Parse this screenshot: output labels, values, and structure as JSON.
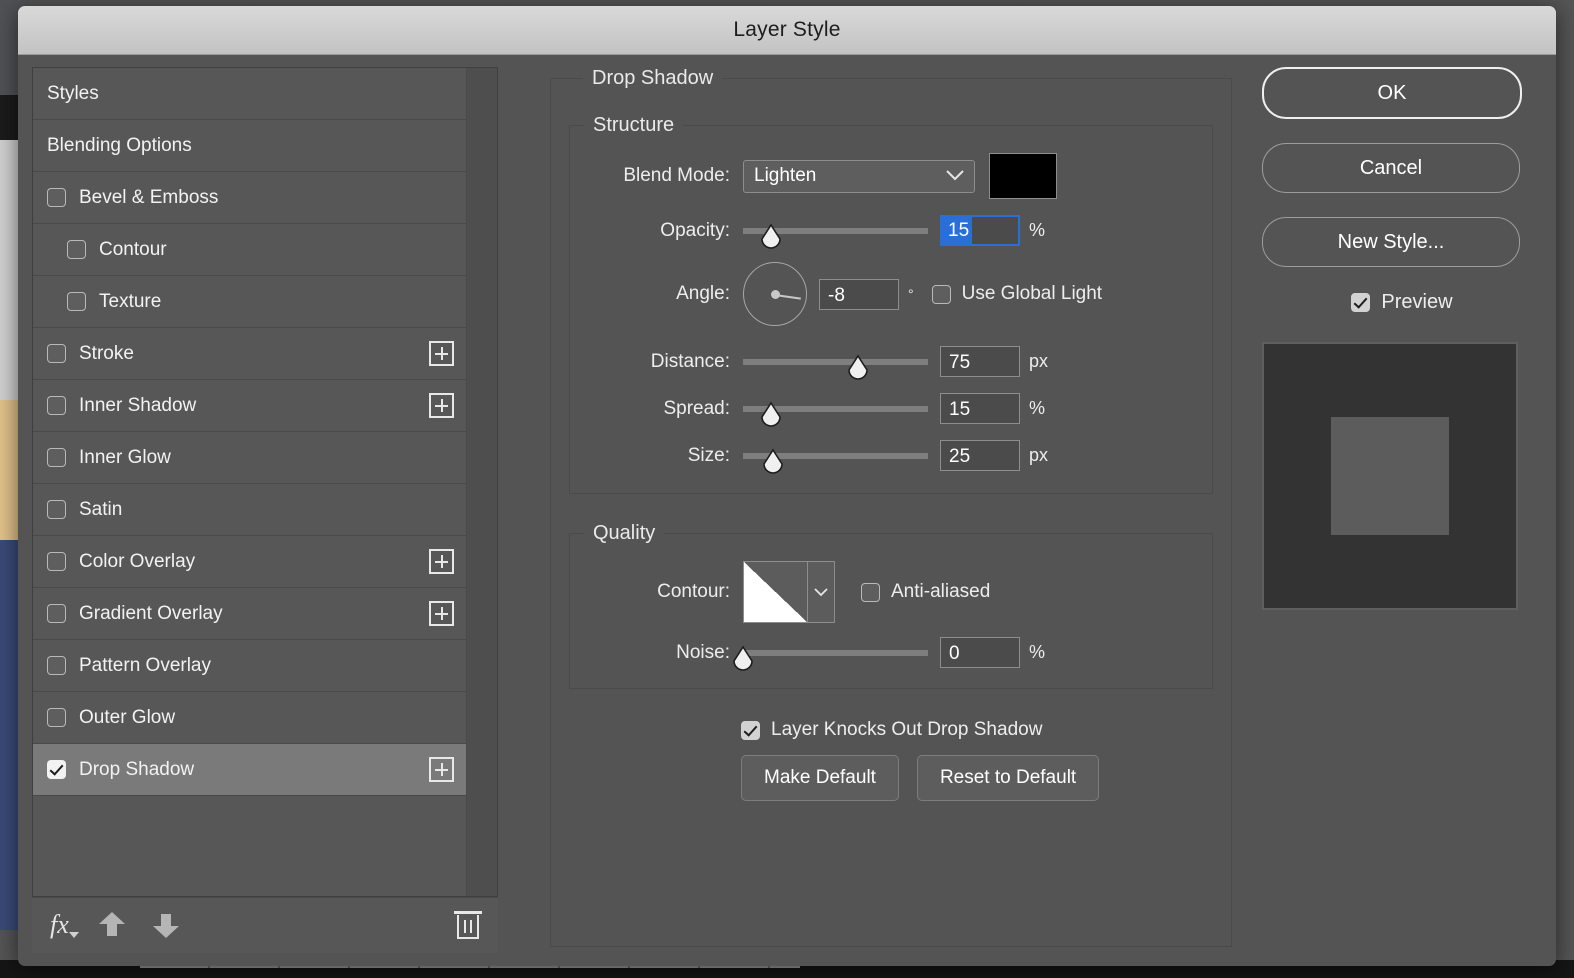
{
  "window": {
    "title": "Layer Style"
  },
  "sidebar": {
    "items": [
      {
        "label": "Styles",
        "type": "plain",
        "checked": false,
        "indent": false,
        "plus": false,
        "selected": false
      },
      {
        "label": "Blending Options",
        "type": "plain",
        "checked": false,
        "indent": false,
        "plus": false,
        "selected": false
      },
      {
        "label": "Bevel & Emboss",
        "type": "check",
        "checked": false,
        "indent": false,
        "plus": false,
        "selected": false
      },
      {
        "label": "Contour",
        "type": "check",
        "checked": false,
        "indent": true,
        "plus": false,
        "selected": false
      },
      {
        "label": "Texture",
        "type": "check",
        "checked": false,
        "indent": true,
        "plus": false,
        "selected": false
      },
      {
        "label": "Stroke",
        "type": "check",
        "checked": false,
        "indent": false,
        "plus": true,
        "selected": false
      },
      {
        "label": "Inner Shadow",
        "type": "check",
        "checked": false,
        "indent": false,
        "plus": true,
        "selected": false
      },
      {
        "label": "Inner Glow",
        "type": "check",
        "checked": false,
        "indent": false,
        "plus": false,
        "selected": false
      },
      {
        "label": "Satin",
        "type": "check",
        "checked": false,
        "indent": false,
        "plus": false,
        "selected": false
      },
      {
        "label": "Color Overlay",
        "type": "check",
        "checked": false,
        "indent": false,
        "plus": true,
        "selected": false
      },
      {
        "label": "Gradient Overlay",
        "type": "check",
        "checked": false,
        "indent": false,
        "plus": true,
        "selected": false
      },
      {
        "label": "Pattern Overlay",
        "type": "check",
        "checked": false,
        "indent": false,
        "plus": false,
        "selected": false
      },
      {
        "label": "Outer Glow",
        "type": "check",
        "checked": false,
        "indent": false,
        "plus": false,
        "selected": false
      },
      {
        "label": "Drop Shadow",
        "type": "check",
        "checked": true,
        "indent": false,
        "plus": true,
        "selected": true
      }
    ],
    "toolbar": {
      "fx_label": "fx",
      "fx_icon": "fx-icon",
      "move_up_icon": "arrow-up-icon",
      "move_down_icon": "arrow-down-icon",
      "delete_icon": "trash-icon"
    }
  },
  "effect_panel": {
    "title": "Drop Shadow",
    "structure": {
      "legend": "Structure",
      "blend_mode_label": "Blend Mode:",
      "blend_mode_value": "Lighten",
      "blend_mode_options": [
        "Lighten"
      ],
      "color_swatch": "#000000",
      "opacity_label": "Opacity:",
      "opacity_value": "15",
      "opacity_unit": "%",
      "opacity_percent": 15,
      "angle_label": "Angle:",
      "angle_value": "-8",
      "angle_unit": "°",
      "use_global_light_label": "Use Global Light",
      "use_global_light_checked": false,
      "distance_label": "Distance:",
      "distance_value": "75",
      "distance_unit": "px",
      "distance_percent": 62,
      "spread_label": "Spread:",
      "spread_value": "15",
      "spread_unit": "%",
      "spread_percent": 15,
      "size_label": "Size:",
      "size_value": "25",
      "size_unit": "px",
      "size_percent": 16
    },
    "quality": {
      "legend": "Quality",
      "contour_label": "Contour:",
      "anti_aliased_label": "Anti-aliased",
      "anti_aliased_checked": false,
      "noise_label": "Noise:",
      "noise_value": "0",
      "noise_unit": "%",
      "noise_percent": 0
    },
    "knockout": {
      "label": "Layer Knocks Out Drop Shadow",
      "checked": true
    },
    "buttons": {
      "make_default": "Make Default",
      "reset_to_default": "Reset to Default"
    }
  },
  "actions": {
    "ok": "OK",
    "cancel": "Cancel",
    "new_style": "New Style...",
    "preview_label": "Preview",
    "preview_checked": true
  },
  "colors": {
    "dialog_bg": "#545454",
    "titlebar": "#cfcfcf",
    "selected_row": "#7a7a7a",
    "focus_blue": "#2a6fd6",
    "swatch": "#000000",
    "preview_bg": "#333333",
    "preview_square": "#5c5c5c"
  }
}
